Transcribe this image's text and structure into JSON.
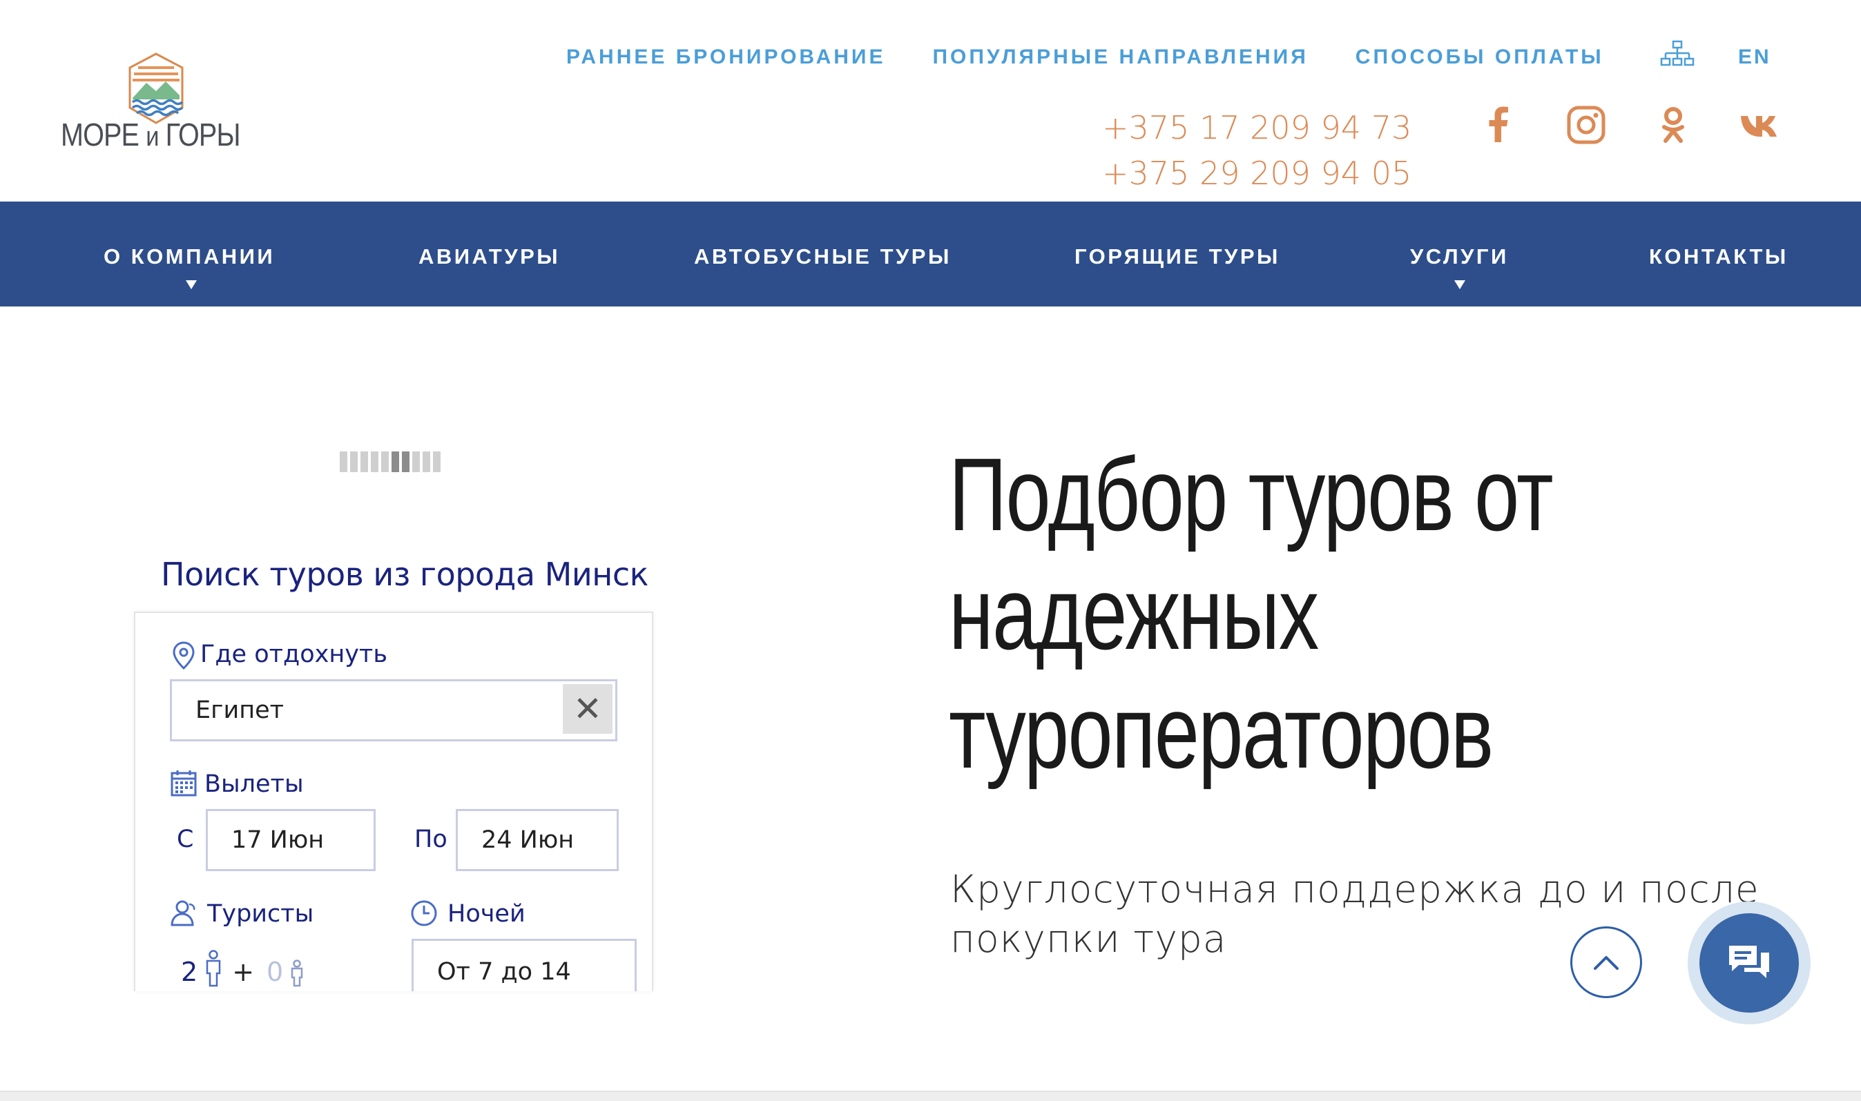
{
  "logo": {
    "text_main": "МОРЕ",
    "text_small": "и",
    "text_end": "ГОРЫ"
  },
  "top_links": [
    {
      "label": "РАННЕЕ БРОНИРОВАНИЕ"
    },
    {
      "label": "ПОПУЛЯРНЫЕ НАПРАВЛЕНИЯ"
    },
    {
      "label": "СПОСОБЫ ОПЛАТЫ"
    }
  ],
  "lang": "EN",
  "phones": [
    "+375 17 209 94 73",
    "+375 29 209 94 05"
  ],
  "social": [
    "facebook-icon",
    "instagram-icon",
    "odnoklassniki-icon",
    "vk-icon"
  ],
  "nav": [
    {
      "label": "О КОМПАНИИ",
      "has_dropdown": true
    },
    {
      "label": "АВИАТУРЫ",
      "has_dropdown": false
    },
    {
      "label": "АВТОБУСНЫЕ ТУРЫ",
      "has_dropdown": false
    },
    {
      "label": "ГОРЯЩИЕ ТУРЫ",
      "has_dropdown": false
    },
    {
      "label": "УСЛУГИ",
      "has_dropdown": true
    },
    {
      "label": "КОНТАКТЫ",
      "has_dropdown": false
    }
  ],
  "search": {
    "title": "Поиск туров из города Минск",
    "destination_label": "Где отдохнуть",
    "destination_value": "Египет",
    "clear_symbol": "✕",
    "departures_label": "Вылеты",
    "from_prefix": "С",
    "from_value": "17 Июн",
    "to_prefix": "По",
    "to_value": "24 Июн",
    "tourists_label": "Туристы",
    "adults": "2",
    "plus": "+",
    "children": "0",
    "nights_label": "Ночей",
    "nights_value": "От 7 до 14"
  },
  "hero": {
    "title_lines": [
      "Подбор туров от",
      "надежных",
      "туроператоров"
    ],
    "subtitle_lines": [
      "Круглосуточная поддержка до и после",
      "покупки тура"
    ]
  },
  "colors": {
    "nav_bg": "#2d4e8b",
    "link_blue": "#4a9ed8",
    "phone_orange": "#dc8a55",
    "widget_blue": "#1a237e",
    "chat_blue": "#3a67a7"
  }
}
